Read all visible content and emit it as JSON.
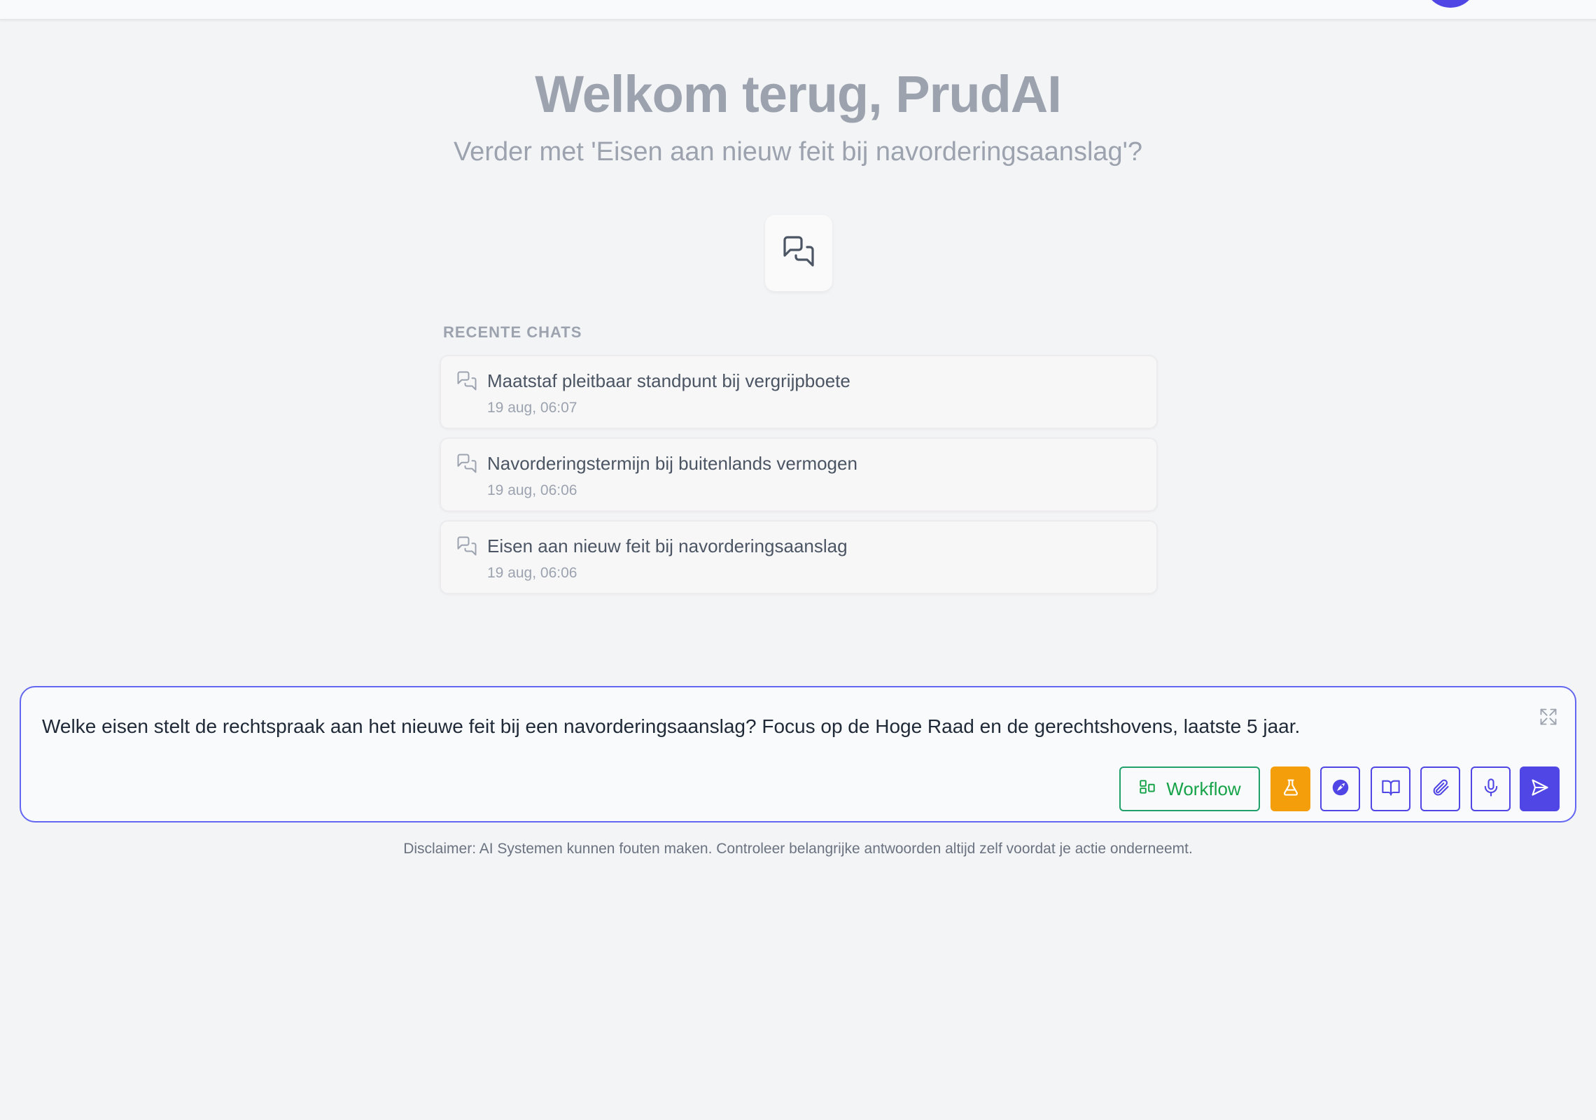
{
  "header": {
    "avatar_color": "#4f46e5"
  },
  "welcome": {
    "title": "Welkom terug, PrudAI",
    "subtitle": "Verder met 'Eisen aan nieuw feit bij navorderingsaanslag'?"
  },
  "recent": {
    "label": "RECENTE CHATS",
    "items": [
      {
        "title": "Maatstaf pleitbaar standpunt bij vergrijpboete",
        "date": "19 aug, 06:07",
        "icon": "chat-bubbles-icon"
      },
      {
        "title": "Navorderingstermijn bij buitenlands vermogen",
        "date": "19 aug, 06:06",
        "icon": "chat-bubbles-icon"
      },
      {
        "title": "Eisen aan nieuw feit bij navorderingsaanslag",
        "date": "19 aug, 06:06",
        "icon": "chat-bubbles-icon"
      }
    ]
  },
  "composer": {
    "value": "Welke eisen stelt de rechtspraak aan het nieuwe feit bij een navorderingsaanslag? Focus op de Hoge Raad en de gerechtshovens, laatste 5 jaar.",
    "workflow_label": "Workflow",
    "buttons": [
      "expand-icon",
      "workflow-icon",
      "flask-icon",
      "rocket-icon",
      "book-icon",
      "paperclip-icon",
      "microphone-icon",
      "send-icon"
    ]
  },
  "disclaimer": "Disclaimer: AI Systemen kunnen fouten maken. Controleer belangrijke antwoorden altijd zelf voordat je actie onderneemt.",
  "colors": {
    "accent": "#4f46e5",
    "workflow_green": "#16a34a",
    "lab_orange": "#f59e0b",
    "background": "#f3f4f6"
  }
}
